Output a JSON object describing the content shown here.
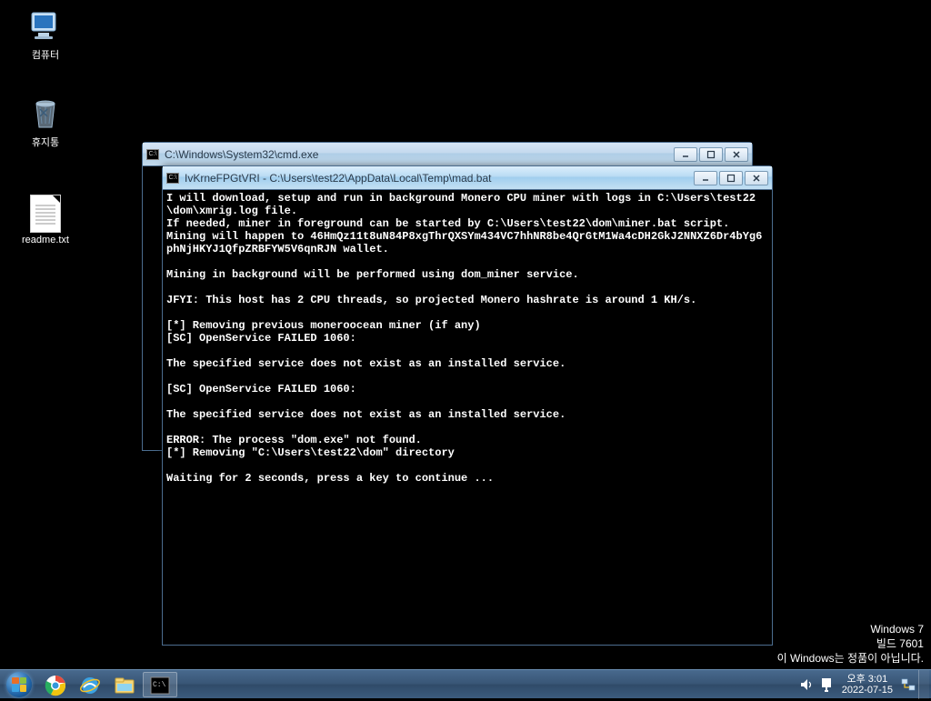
{
  "desktop": {
    "computer_label": "컴퓨터",
    "recycle_label": "휴지통",
    "readme_label": "readme.txt"
  },
  "window_back": {
    "title": "C:\\Windows\\System32\\cmd.exe"
  },
  "window_front": {
    "title": "IvKrneFPGtVRI - C:\\Users\\test22\\AppData\\Local\\Temp\\mad.bat",
    "terminal_text": "I will download, setup and run in background Monero CPU miner with logs in C:\\Users\\test22\\dom\\xmrig.log file.\nIf needed, miner in foreground can be started by C:\\Users\\test22\\dom\\miner.bat script.\nMining will happen to 46HmQz11t8uN84P8xgThrQXSYm434VC7hhNR8be4QrGtM1Wa4cDH2GkJ2NNXZ6Dr4bYg6phNjHKYJ1QfpZRBFYW5V6qnRJN wallet.\n\nMining in background will be performed using dom_miner service.\n\nJFYI: This host has 2 CPU threads, so projected Monero hashrate is around 1 KH/s.\n\n[*] Removing previous moneroocean miner (if any)\n[SC] OpenService FAILED 1060:\n\nThe specified service does not exist as an installed service.\n\n[SC] OpenService FAILED 1060:\n\nThe specified service does not exist as an installed service.\n\nERROR: The process \"dom.exe\" not found.\n[*] Removing \"C:\\Users\\test22\\dom\" directory\n\nWaiting for 2 seconds, press a key to continue ..."
  },
  "watermark": {
    "line1": "Windows 7",
    "line2": "빌드 7601",
    "line3": "이 Windows는 정품이 아닙니다."
  },
  "clock": {
    "time": "오후 3:01",
    "date": "2022-07-15"
  }
}
